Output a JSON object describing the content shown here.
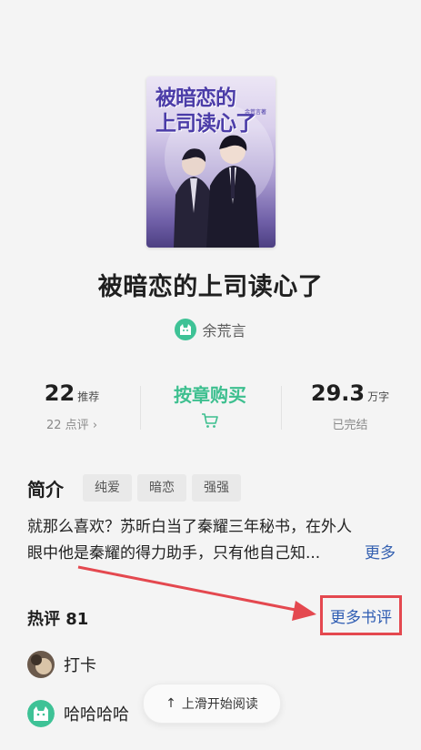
{
  "cover": {
    "title_line1": "被暗恋的",
    "title_line2": "上司读心了",
    "author_tag": "余荒言著"
  },
  "book": {
    "title": "被暗恋的上司读心了",
    "author": "余荒言"
  },
  "stats": {
    "recommend_num": "22",
    "recommend_unit": "推荐",
    "reviews_sub": "22 点评",
    "buy_label": "按章购买",
    "words_num": "29.3",
    "words_unit": "万字",
    "status": "已完结"
  },
  "intro": {
    "heading": "简介",
    "tags": [
      "纯爱",
      "暗恋",
      "强强"
    ],
    "line1": "就那么喜欢？苏昕白当了秦耀三年秘书，在外人",
    "line2": "眼中他是秦耀的得力助手，只有他自己知...",
    "more": "更多"
  },
  "hot": {
    "title": "热评 81",
    "more_reviews": "更多书评"
  },
  "reviews": [
    {
      "text": "打卡"
    },
    {
      "text": "哈哈哈哈"
    }
  ],
  "read_button": {
    "label": "上滑开始阅读"
  },
  "colors": {
    "accent_green": "#3dbf8f",
    "link_blue": "#3460b0",
    "annotation_red": "#e4484f"
  }
}
